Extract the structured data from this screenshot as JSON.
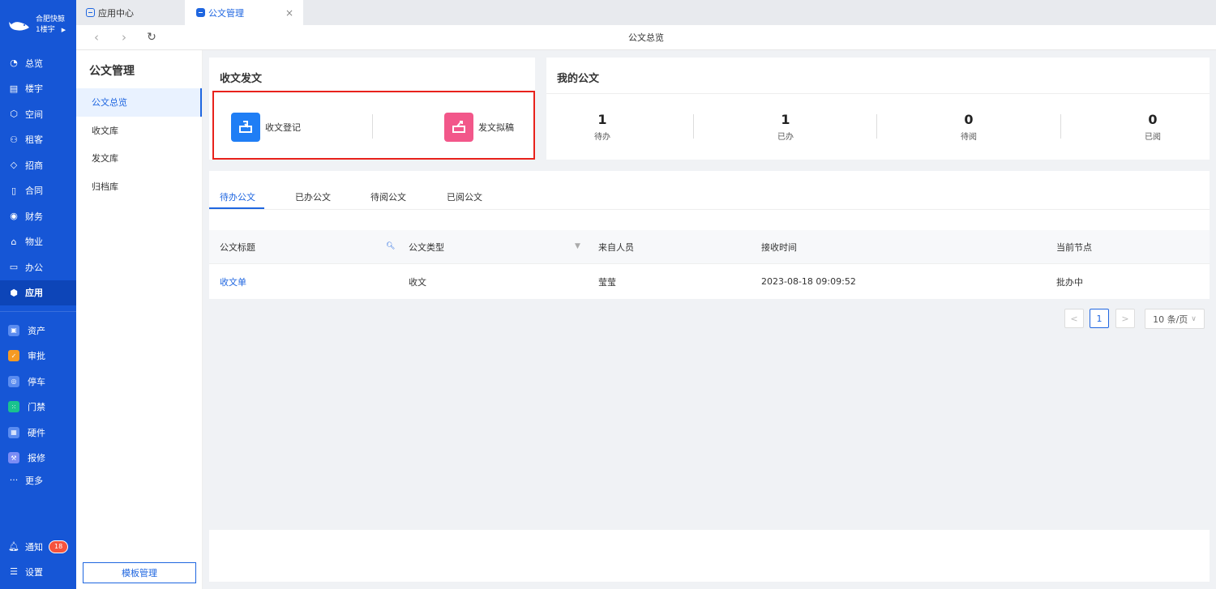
{
  "brand": {
    "company": "合肥快鲸",
    "building": "1楼宇"
  },
  "nav_main": [
    {
      "label": "总览",
      "icon": "dashboard-icon"
    },
    {
      "label": "楼宇",
      "icon": "building-icon"
    },
    {
      "label": "空间",
      "icon": "cube-icon"
    },
    {
      "label": "租客",
      "icon": "users-icon"
    },
    {
      "label": "招商",
      "icon": "tag-icon"
    },
    {
      "label": "合同",
      "icon": "contract-icon"
    },
    {
      "label": "财务",
      "icon": "coin-icon"
    },
    {
      "label": "物业",
      "icon": "home-icon"
    },
    {
      "label": "办公",
      "icon": "monitor-icon"
    },
    {
      "label": "应用",
      "icon": "app-cube-icon"
    }
  ],
  "nav_apps": [
    {
      "label": "资产",
      "color": "#5b8cf0"
    },
    {
      "label": "审批",
      "color": "#f59a23"
    },
    {
      "label": "停车",
      "color": "#5b8cf0"
    },
    {
      "label": "门禁",
      "color": "#19c28e"
    },
    {
      "label": "硬件",
      "color": "#5b8cf0"
    },
    {
      "label": "报修",
      "color": "#7b8cf5"
    }
  ],
  "nav_more": "更多",
  "nav_bottom": {
    "notify": "通知",
    "notify_count": "18",
    "settings": "设置"
  },
  "tabs": {
    "tab1": "应用中心",
    "tab2": "公文管理",
    "close": "×"
  },
  "address": {
    "title": "公文总览"
  },
  "sub": {
    "title": "公文管理",
    "items": [
      "公文总览",
      "收文库",
      "发文库",
      "归档库"
    ],
    "template_button": "模板管理"
  },
  "card_send": {
    "title": "收文发文",
    "register": "收文登记",
    "draft": "发文拟稿"
  },
  "card_mine": {
    "title": "我的公文",
    "stats": [
      {
        "num": "1",
        "label": "待办"
      },
      {
        "num": "1",
        "label": "已办"
      },
      {
        "num": "0",
        "label": "待阅"
      },
      {
        "num": "0",
        "label": "已阅"
      }
    ]
  },
  "doc_tabs": [
    "待办公文",
    "已办公文",
    "待阅公文",
    "已阅公文"
  ],
  "table": {
    "headers": [
      "公文标题",
      "公文类型",
      "来自人员",
      "接收时间",
      "当前节点"
    ],
    "rows": [
      [
        "收文单",
        "收文",
        "莹莹",
        "2023-08-18 09:09:52",
        "批办中"
      ]
    ]
  },
  "pager": {
    "prev": "<",
    "page": "1",
    "next": ">",
    "size": "10 条/页"
  },
  "colors": {
    "sidebar": "#1656d6",
    "accent": "#1f66e0",
    "highlight": "#e8221c"
  }
}
